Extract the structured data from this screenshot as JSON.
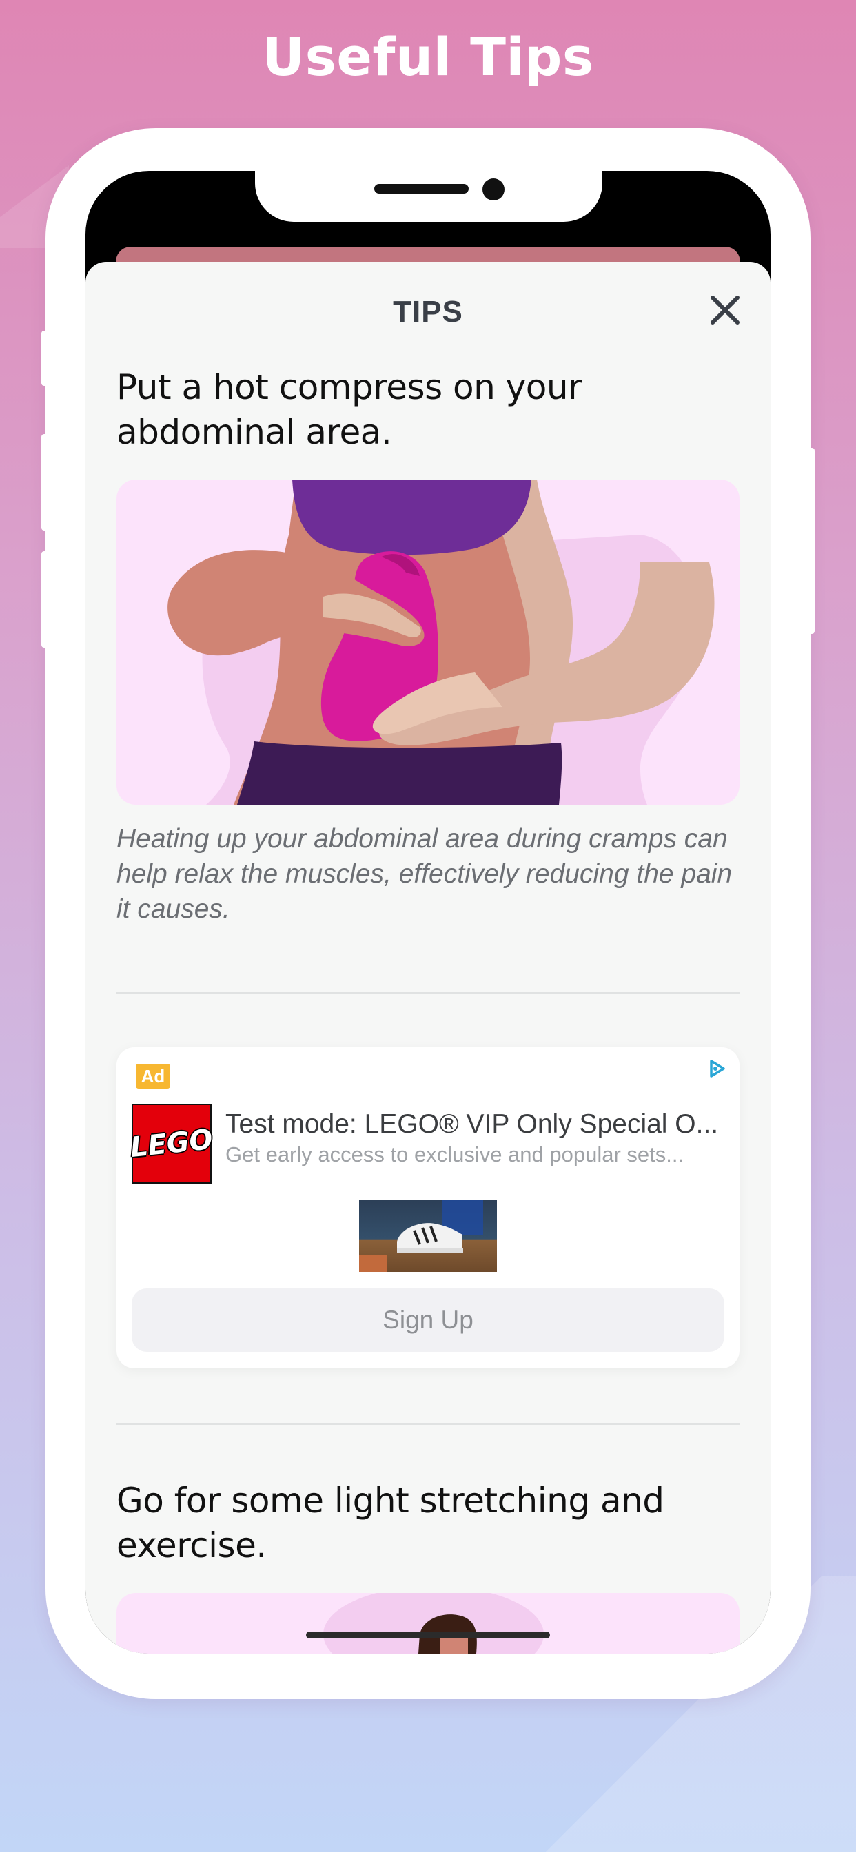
{
  "headline": "Useful Tips",
  "sheet": {
    "title": "TIPS"
  },
  "tips": [
    {
      "heading": "Put a hot compress on your abdominal area.",
      "description": "Heating up your abdominal area during cramps can help relax the muscles, effectively reducing the pain it causes."
    },
    {
      "heading": "Go for some light stretching and exercise."
    }
  ],
  "ad": {
    "badge": "Ad",
    "logo_text": "LEGO",
    "title": "Test mode: LEGO® VIP Only Special O...",
    "subtitle": "Get early access to exclusive and popular sets...",
    "cta": "Sign Up"
  },
  "colors": {
    "sheet_background": "#f6f7f6",
    "ad_badge": "#f7b731",
    "lego_red": "#e3000b",
    "illustration_background": "#fce3fb"
  },
  "icons": {
    "close": "close-icon",
    "adchoices": "adchoices-icon"
  }
}
